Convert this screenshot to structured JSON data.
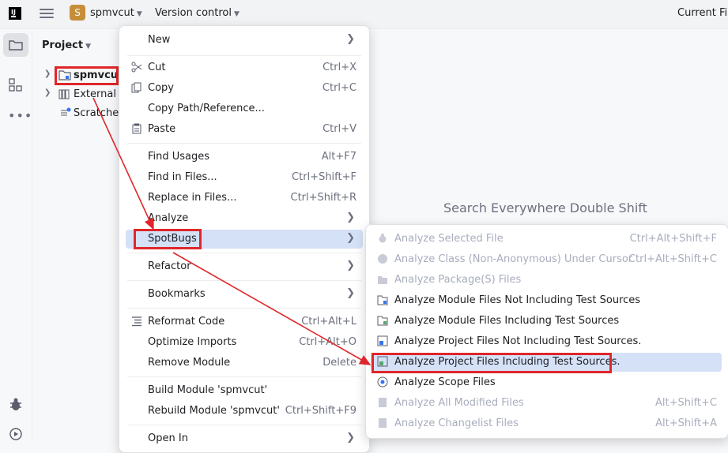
{
  "titlebar": {
    "logo_text": "IJ",
    "project_badge": "S",
    "project_name": "spmvcut",
    "vcs_label": "Version control",
    "current_file": "Current File"
  },
  "project_panel": {
    "title": "Project",
    "tree": [
      {
        "label": "spmvcut",
        "icon": "module-folder-icon"
      },
      {
        "label": "External Libraries",
        "icon": "library-icon"
      },
      {
        "label": "Scratches and Consoles",
        "icon": "scratches-icon"
      }
    ]
  },
  "editor": {
    "search_hint": "Search Everywhere Double Shift"
  },
  "context_menu": {
    "items": [
      {
        "label": "New",
        "submenu": true
      },
      {
        "label": "Cut",
        "shortcut": "Ctrl+X",
        "icon": "scissors-icon"
      },
      {
        "label": "Copy",
        "shortcut": "Ctrl+C",
        "icon": "copy-icon"
      },
      {
        "label": "Copy Path/Reference..."
      },
      {
        "label": "Paste",
        "shortcut": "Ctrl+V",
        "icon": "paste-icon"
      },
      {
        "label": "Find Usages",
        "shortcut": "Alt+F7"
      },
      {
        "label": "Find in Files...",
        "shortcut": "Ctrl+Shift+F"
      },
      {
        "label": "Replace in Files...",
        "shortcut": "Ctrl+Shift+R"
      },
      {
        "label": "Analyze",
        "submenu": true
      },
      {
        "label": "SpotBugs",
        "submenu": true
      },
      {
        "label": "Refactor",
        "submenu": true
      },
      {
        "label": "Bookmarks",
        "submenu": true
      },
      {
        "label": "Reformat Code",
        "shortcut": "Ctrl+Alt+L",
        "icon": "reformat-icon"
      },
      {
        "label": "Optimize Imports",
        "shortcut": "Ctrl+Alt+O"
      },
      {
        "label": "Remove Module",
        "shortcut": "Delete"
      },
      {
        "label": "Build Module 'spmvcut'"
      },
      {
        "label": "Rebuild Module 'spmvcut'",
        "shortcut": "Ctrl+Shift+F9"
      },
      {
        "label": "Open In",
        "submenu": true
      }
    ]
  },
  "spotbugs_submenu": {
    "items": [
      {
        "label": "Analyze Selected File",
        "shortcut": "Ctrl+Alt+Shift+F",
        "enabled": false
      },
      {
        "label": "Analyze Class (Non-Anonymous) Under Cursor",
        "shortcut": "Ctrl+Alt+Shift+C",
        "enabled": false
      },
      {
        "label": "Analyze Package(S) Files",
        "enabled": false
      },
      {
        "label": "Analyze Module Files Not Including Test Sources",
        "enabled": true
      },
      {
        "label": "Analyze Module Files Including Test Sources",
        "enabled": true
      },
      {
        "label": "Analyze Project Files Not Including Test Sources.",
        "enabled": true
      },
      {
        "label": "Analyze Project Files Including Test Sources.",
        "enabled": true
      },
      {
        "label": "Analyze Scope Files",
        "enabled": true
      },
      {
        "label": "Analyze All Modified Files",
        "shortcut": "Alt+Shift+C",
        "enabled": false
      },
      {
        "label": "Analyze Changelist Files",
        "shortcut": "Alt+Shift+A",
        "enabled": false
      }
    ]
  },
  "colors": {
    "annotation_red": "#e0262a",
    "selection_blue": "#d5e1f7",
    "project_badge": "#c68e3b"
  }
}
